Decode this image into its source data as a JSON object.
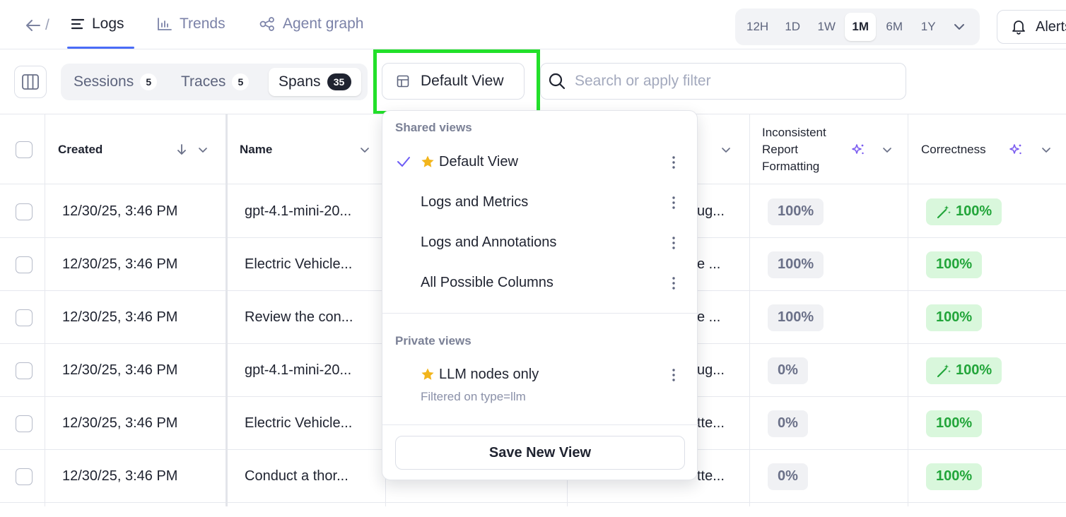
{
  "nav": {
    "tabs": [
      {
        "label": "Logs"
      },
      {
        "label": "Trends"
      },
      {
        "label": "Agent graph"
      }
    ],
    "back_separator": "/",
    "time_ranges": [
      "12H",
      "1D",
      "1W",
      "1M",
      "6M",
      "1Y"
    ],
    "selected_range": "1M",
    "alerts_label": "Alerts"
  },
  "toolbar": {
    "segments": [
      {
        "label": "Sessions",
        "count": "5"
      },
      {
        "label": "Traces",
        "count": "5"
      },
      {
        "label": "Spans",
        "count": "35"
      }
    ],
    "selected_segment": "Spans",
    "view_label": "Default View",
    "search_placeholder": "Search or apply filter"
  },
  "table": {
    "headers": {
      "created": "Created",
      "name": "Name",
      "inconsistent": "Inconsistent Report Formatting",
      "correctness": "Correctness"
    },
    "rows": [
      {
        "created": "12/30/25, 3:46 PM",
        "name": "gpt-4.1-mini-20...",
        "hidden": "ug...",
        "inconsistent": "100%",
        "correctness": "100%",
        "correctness_icon": true
      },
      {
        "created": "12/30/25, 3:46 PM",
        "name": "Electric Vehicle...",
        "hidden": "e ...",
        "inconsistent": "100%",
        "correctness": "100%",
        "correctness_icon": false
      },
      {
        "created": "12/30/25, 3:46 PM",
        "name": "Review the con...",
        "hidden": "e ...",
        "inconsistent": "100%",
        "correctness": "100%",
        "correctness_icon": false
      },
      {
        "created": "12/30/25, 3:46 PM",
        "name": "gpt-4.1-mini-20...",
        "hidden": "ug...",
        "inconsistent": "0%",
        "correctness": "100%",
        "correctness_icon": true
      },
      {
        "created": "12/30/25, 3:46 PM",
        "name": "Electric Vehicle...",
        "hidden": "tte...",
        "inconsistent": "0%",
        "correctness": "100%",
        "correctness_icon": false
      },
      {
        "created": "12/30/25, 3:46 PM",
        "name": "Conduct a thor...",
        "hidden": "tte...",
        "inconsistent": "0%",
        "correctness": "100%",
        "correctness_icon": false
      }
    ]
  },
  "dropdown": {
    "shared_title": "Shared views",
    "shared": [
      {
        "label": "Default View",
        "starred": true,
        "checked": true
      },
      {
        "label": "Logs and Metrics",
        "starred": false,
        "checked": false
      },
      {
        "label": "Logs and Annotations",
        "starred": false,
        "checked": false
      },
      {
        "label": "All Possible Columns",
        "starred": false,
        "checked": false
      }
    ],
    "private_title": "Private views",
    "private": [
      {
        "label": "LLM nodes only",
        "starred": true,
        "subtitle": "Filtered on type=llm"
      }
    ],
    "save_label": "Save New View"
  },
  "colors": {
    "accent": "#4a6cf7",
    "highlight": "#22e02a",
    "check": "#6d5cf5",
    "star": "#f2b51c",
    "sparkle": "#7b5cf0",
    "pass": "#22a53a"
  }
}
